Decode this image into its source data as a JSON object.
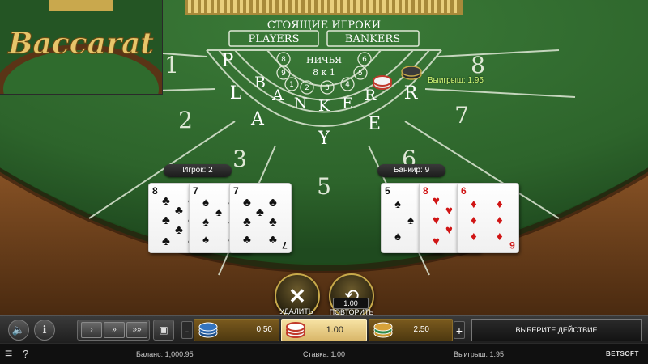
{
  "game": {
    "title": "Baccarat"
  },
  "table": {
    "standing_title": "СТОЯЩИЕ ИГРОКИ",
    "players_label": "PLAYERS",
    "bankers_label": "BANKERS",
    "tie_label": "НИЧЬЯ",
    "tie_odds": "8 к 1",
    "banker_word": "BANKER",
    "player_word": "PLAYER",
    "seat_numbers": [
      "1",
      "2",
      "3",
      "5",
      "6",
      "7",
      "8"
    ],
    "pair_markers": [
      "8",
      "9",
      "1",
      "2",
      "3",
      "4",
      "5",
      "6",
      "7"
    ]
  },
  "win": {
    "label": "Выигрыш: 1.95"
  },
  "hands": {
    "player": {
      "score_label": "Игрок: 2",
      "cards": [
        {
          "rank": "8",
          "suit": "♣",
          "color": "black"
        },
        {
          "rank": "7",
          "suit": "♠",
          "color": "black"
        },
        {
          "rank": "7",
          "suit": "♣",
          "color": "black"
        }
      ]
    },
    "banker": {
      "score_label": "Банкир: 9",
      "cards": [
        {
          "rank": "5",
          "suit": "♠",
          "color": "black"
        },
        {
          "rank": "8",
          "suit": "♥",
          "color": "red"
        },
        {
          "rank": "6",
          "suit": "♦",
          "color": "red"
        }
      ]
    }
  },
  "buttons": {
    "delete": {
      "label": "УДАЛИТЬ",
      "icon": "x-icon"
    },
    "repeat": {
      "label": "ПОВТОРИТЬ",
      "value": "1.00",
      "icon": "repeat-icon"
    }
  },
  "controls": {
    "speed_labels": [
      "›",
      "»",
      "»»"
    ],
    "chips": [
      {
        "value": "0.50",
        "selected": false
      },
      {
        "value": "1.00",
        "selected": true
      },
      {
        "value": "2.50",
        "selected": false
      }
    ],
    "minus": "-",
    "plus": "+",
    "action_label": "ВЫБЕРИТЕ ДЕЙСТВИЕ",
    "info_glyph": "i"
  },
  "status": {
    "balance": "Баланс: 1,000.95",
    "bet": "Ставка: 1.00",
    "win": "Выигрыш: 1.95",
    "help": "?",
    "brand": "BETSOFT"
  },
  "colors": {
    "felt": "#2f6b2d",
    "felt_dark": "#1f4a1f",
    "rail": "#6b3b1d",
    "gold": "#c7a94a",
    "win_green": "#d8ff7a"
  }
}
